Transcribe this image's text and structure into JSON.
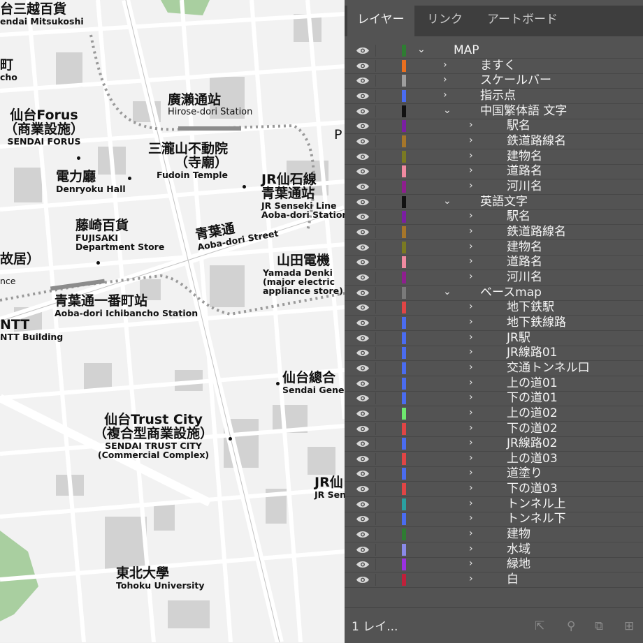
{
  "map": {
    "labels": [
      {
        "ja": "台三越百貨",
        "en": "endai Mitsukoshi"
      },
      {
        "ja": "町",
        "en": "cho"
      },
      {
        "ja": "廣瀨通站",
        "en": "Hirose-dori Station"
      },
      {
        "ja": "仙台Forus",
        "ja2": "（商業設施）",
        "en": "SENDAI FORUS"
      },
      {
        "ja": "三瀧山不動院",
        "ja2": "（寺廟）",
        "en": "Fudoin Temple"
      },
      {
        "ja": "JR仙石線",
        "ja2": "青葉通站",
        "en": "JR Senseki Line",
        "en2": "Aoba-dori Station"
      },
      {
        "ja": "電力廳",
        "en": "Denryoku Hall"
      },
      {
        "ja": "藤崎百貨",
        "en": "FUJISAKI",
        "en2": "Department Store"
      },
      {
        "ja": "青葉通",
        "en": "Aoba-dori Street"
      },
      {
        "ja": "山田電機",
        "en": "Yamada Denki",
        "en2": "(major electric",
        "en3": "appliance store)"
      },
      {
        "ja": "故居）",
        "en": "nce"
      },
      {
        "ja": "青葉通一番町站",
        "en": "Aoba-dori Ichibancho Station"
      },
      {
        "ja": "NTT",
        "en": "NTT Building"
      },
      {
        "ja": "仙台總合",
        "en": "Sendai Gener"
      },
      {
        "ja": "仙台Trust City",
        "ja2": "（複合型商業設施）",
        "en": "SENDAI TRUST CITY",
        "en2": "(Commercial Complex)"
      },
      {
        "ja": "JR仙",
        "en": "JR Sen"
      },
      {
        "ja": "東北大學",
        "en": "Tohoku University"
      },
      {
        "ja": "P",
        "en": ""
      }
    ]
  },
  "panel": {
    "tabs": [
      "レイヤー",
      "リンク",
      "アートボード"
    ],
    "active_tab": "レイヤー",
    "layers": [
      {
        "name": "MAP",
        "depth": 0,
        "expanded": true,
        "color": "#2e7d32"
      },
      {
        "name": "ますく",
        "depth": 1,
        "expanded": false,
        "color": "#e86f1f"
      },
      {
        "name": "スケールバー",
        "depth": 1,
        "expanded": false,
        "color": "#9e9e9e"
      },
      {
        "name": "指示点",
        "depth": 1,
        "expanded": false,
        "color": "#4a6cf0"
      },
      {
        "name": "中国繁体語 文字",
        "depth": 1,
        "expanded": true,
        "color": "#111111"
      },
      {
        "name": "駅名",
        "depth": 2,
        "expanded": false,
        "color": "#7b1fa2"
      },
      {
        "name": "鉄道路線名",
        "depth": 2,
        "expanded": false,
        "color": "#a6762a"
      },
      {
        "name": "建物名",
        "depth": 2,
        "expanded": false,
        "color": "#7a7a22"
      },
      {
        "name": "道路名",
        "depth": 2,
        "expanded": false,
        "color": "#f08aa0"
      },
      {
        "name": "河川名",
        "depth": 2,
        "expanded": false,
        "color": "#8e1f8e"
      },
      {
        "name": "英語文字",
        "depth": 1,
        "expanded": true,
        "color": "#111111"
      },
      {
        "name": "駅名",
        "depth": 2,
        "expanded": false,
        "color": "#7b1fa2"
      },
      {
        "name": "鉄道路線名",
        "depth": 2,
        "expanded": false,
        "color": "#a6762a"
      },
      {
        "name": "建物名",
        "depth": 2,
        "expanded": false,
        "color": "#7a7a22"
      },
      {
        "name": "道路名",
        "depth": 2,
        "expanded": false,
        "color": "#f08aa0"
      },
      {
        "name": "河川名",
        "depth": 2,
        "expanded": false,
        "color": "#8e1f8e"
      },
      {
        "name": "ベースmap",
        "depth": 1,
        "expanded": true,
        "color": "#7a7a7a"
      },
      {
        "name": "地下鉄駅",
        "depth": 2,
        "expanded": false,
        "color": "#e04545"
      },
      {
        "name": "地下鉄線路",
        "depth": 2,
        "expanded": false,
        "color": "#4a6cf0"
      },
      {
        "name": "JR駅",
        "depth": 2,
        "expanded": false,
        "color": "#4a6cf0"
      },
      {
        "name": "JR線路01",
        "depth": 2,
        "expanded": false,
        "color": "#4a6cf0"
      },
      {
        "name": "交通トンネル口",
        "depth": 2,
        "expanded": false,
        "color": "#4a6cf0"
      },
      {
        "name": "上の道01",
        "depth": 2,
        "expanded": false,
        "color": "#4a6cf0"
      },
      {
        "name": "下の道01",
        "depth": 2,
        "expanded": false,
        "color": "#4a6cf0"
      },
      {
        "name": "上の道02",
        "depth": 2,
        "expanded": false,
        "color": "#6ee86e"
      },
      {
        "name": "下の道02",
        "depth": 2,
        "expanded": false,
        "color": "#e04545"
      },
      {
        "name": "JR線路02",
        "depth": 2,
        "expanded": false,
        "color": "#4a6cf0"
      },
      {
        "name": "上の道03",
        "depth": 2,
        "expanded": false,
        "color": "#e04545"
      },
      {
        "name": "道塗り",
        "depth": 2,
        "expanded": false,
        "color": "#4a6cf0"
      },
      {
        "name": "下の道03",
        "depth": 2,
        "expanded": false,
        "color": "#e04545"
      },
      {
        "name": "トンネル上",
        "depth": 2,
        "expanded": false,
        "color": "#2aa0a0"
      },
      {
        "name": "トンネル下",
        "depth": 2,
        "expanded": false,
        "color": "#4a6cf0"
      },
      {
        "name": "建物",
        "depth": 2,
        "expanded": false,
        "color": "#2e7d32"
      },
      {
        "name": "水域",
        "depth": 2,
        "expanded": false,
        "color": "#8a8ae8"
      },
      {
        "name": "緑地",
        "depth": 2,
        "expanded": false,
        "color": "#9b30e0"
      },
      {
        "name": "白",
        "depth": 2,
        "expanded": false,
        "color": "#c0203a"
      }
    ],
    "footer": {
      "count": "1 レイ..."
    }
  }
}
